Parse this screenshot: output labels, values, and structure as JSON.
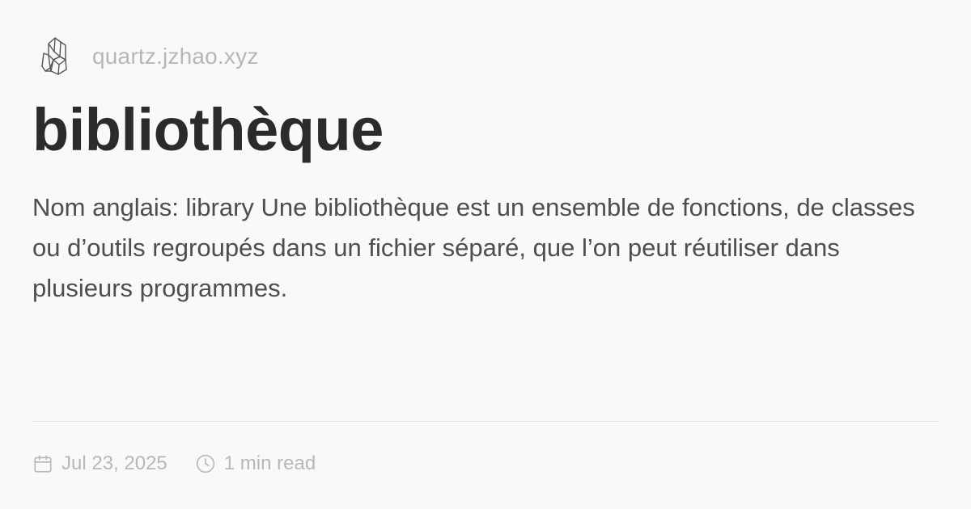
{
  "header": {
    "site_url": "quartz.jzhao.xyz",
    "logo_icon": "crystal-icon"
  },
  "title": "bibliothèque",
  "description": "Nom anglais: library Une bibliothèque est un ensemble de fonctions, de classes ou d’outils regroupés dans un fichier séparé, que l’on peut réutiliser dans plusieurs programmes.",
  "meta": {
    "date": "Jul 23, 2025",
    "date_icon": "calendar-icon",
    "read_time": "1 min read",
    "read_time_icon": "clock-icon"
  },
  "colors": {
    "background": "#faf8f8",
    "title": "#2b2b2b",
    "body_text": "#4e4e4e",
    "muted": "#b9b6b6",
    "divider": "#e6e3e3"
  }
}
